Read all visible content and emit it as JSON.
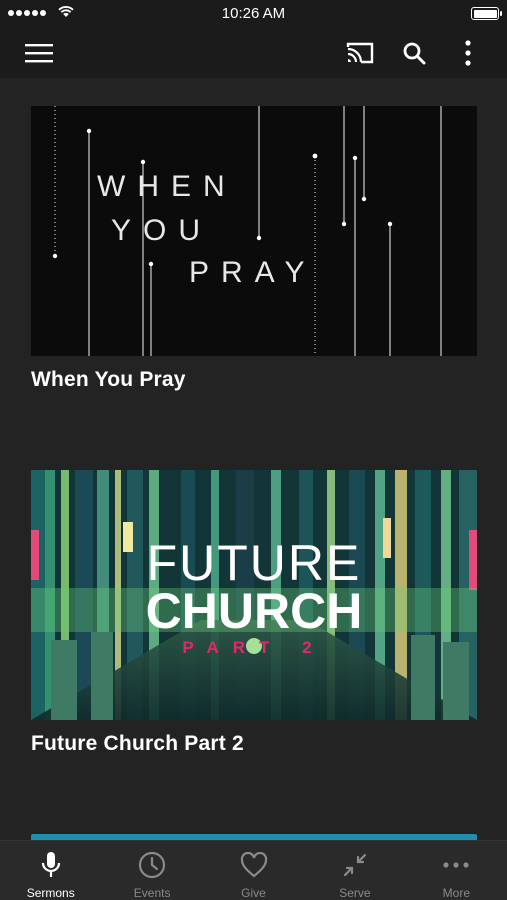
{
  "status_bar": {
    "time": "10:26 AM"
  },
  "app_bar": {
    "icons": [
      "menu-icon",
      "cast-icon",
      "search-icon",
      "more-vertical-icon"
    ]
  },
  "sermons": [
    {
      "title": "When You Pray",
      "art": {
        "lines": [
          "WHEN",
          "YOU",
          "PRAY"
        ]
      }
    },
    {
      "title": "Future Church Part 2",
      "art": {
        "line1": "FUTURE",
        "line2": "CHURCH",
        "line3": "PART 2",
        "accent": "#e7266a"
      }
    }
  ],
  "tab_bar": {
    "items": [
      {
        "label": "Sermons",
        "icon": "microphone-icon",
        "active": true
      },
      {
        "label": "Events",
        "icon": "clock-icon",
        "active": false
      },
      {
        "label": "Give",
        "icon": "heart-icon",
        "active": false
      },
      {
        "label": "Serve",
        "icon": "compress-arrows-icon",
        "active": false
      },
      {
        "label": "More",
        "icon": "more-horizontal-icon",
        "active": false
      }
    ]
  },
  "colors": {
    "background": "#1b1b1b",
    "content": "#232323",
    "tab_active": "#ffffff",
    "tab_inactive": "#8a8a8a",
    "next_card_accent": "#1e8fb0"
  }
}
